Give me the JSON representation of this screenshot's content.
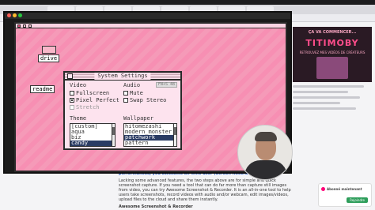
{
  "menubar": {
    "clock": ""
  },
  "desktop": {
    "icons": [
      {
        "label": "drive"
      },
      {
        "label": "readme"
      }
    ]
  },
  "settings": {
    "title": "System Settings",
    "video": {
      "heading": "Video",
      "options": [
        {
          "label": "Fullscreen",
          "checked": false,
          "disabled": false
        },
        {
          "label": "Pixel Perfect",
          "checked": true,
          "disabled": false
        },
        {
          "label": "Stretch",
          "checked": false,
          "disabled": true
        }
      ]
    },
    "audio": {
      "heading": "Audio",
      "options": [
        {
          "label": "Mute",
          "checked": false
        },
        {
          "label": "Swap Stereo",
          "checked": false
        }
      ],
      "badge": "FN+S 48"
    },
    "theme": {
      "heading": "Theme",
      "items": [
        "[custom]",
        "aqua",
        "biz",
        "candy"
      ],
      "selected_index": 3
    },
    "wallpaper": {
      "heading": "Wallpaper",
      "items": [
        "hitomezashi",
        "modern_monster",
        "patchwork",
        "pattern"
      ],
      "selected_index": 2
    }
  },
  "promo": {
    "header": "ÇA VA COMMENCER...",
    "logo": "TITIMOBY",
    "subtitle": "RETROUVEZ MES VIDÉOS DE CRÉATEURS"
  },
  "caption": {
    "heading": "performances, you awesome all-time user (Screen Recorder)",
    "body": "Lacking some advanced features, the two steps above are for simple and quick screenshot capture. If you need a tool that can do far more than capture still images from video, you can try Awesome Screenshot & Recorder. It is an all-in-one tool to help users take screenshots, record videos with audio and/or webcam, edit images/videos, upload files to the cloud and share them instantly.",
    "video_title": "Awesome Screenshot & Recorder"
  },
  "toast": {
    "title": "Abonné maintenant",
    "subtitle": "",
    "button": "Rejoindre"
  }
}
